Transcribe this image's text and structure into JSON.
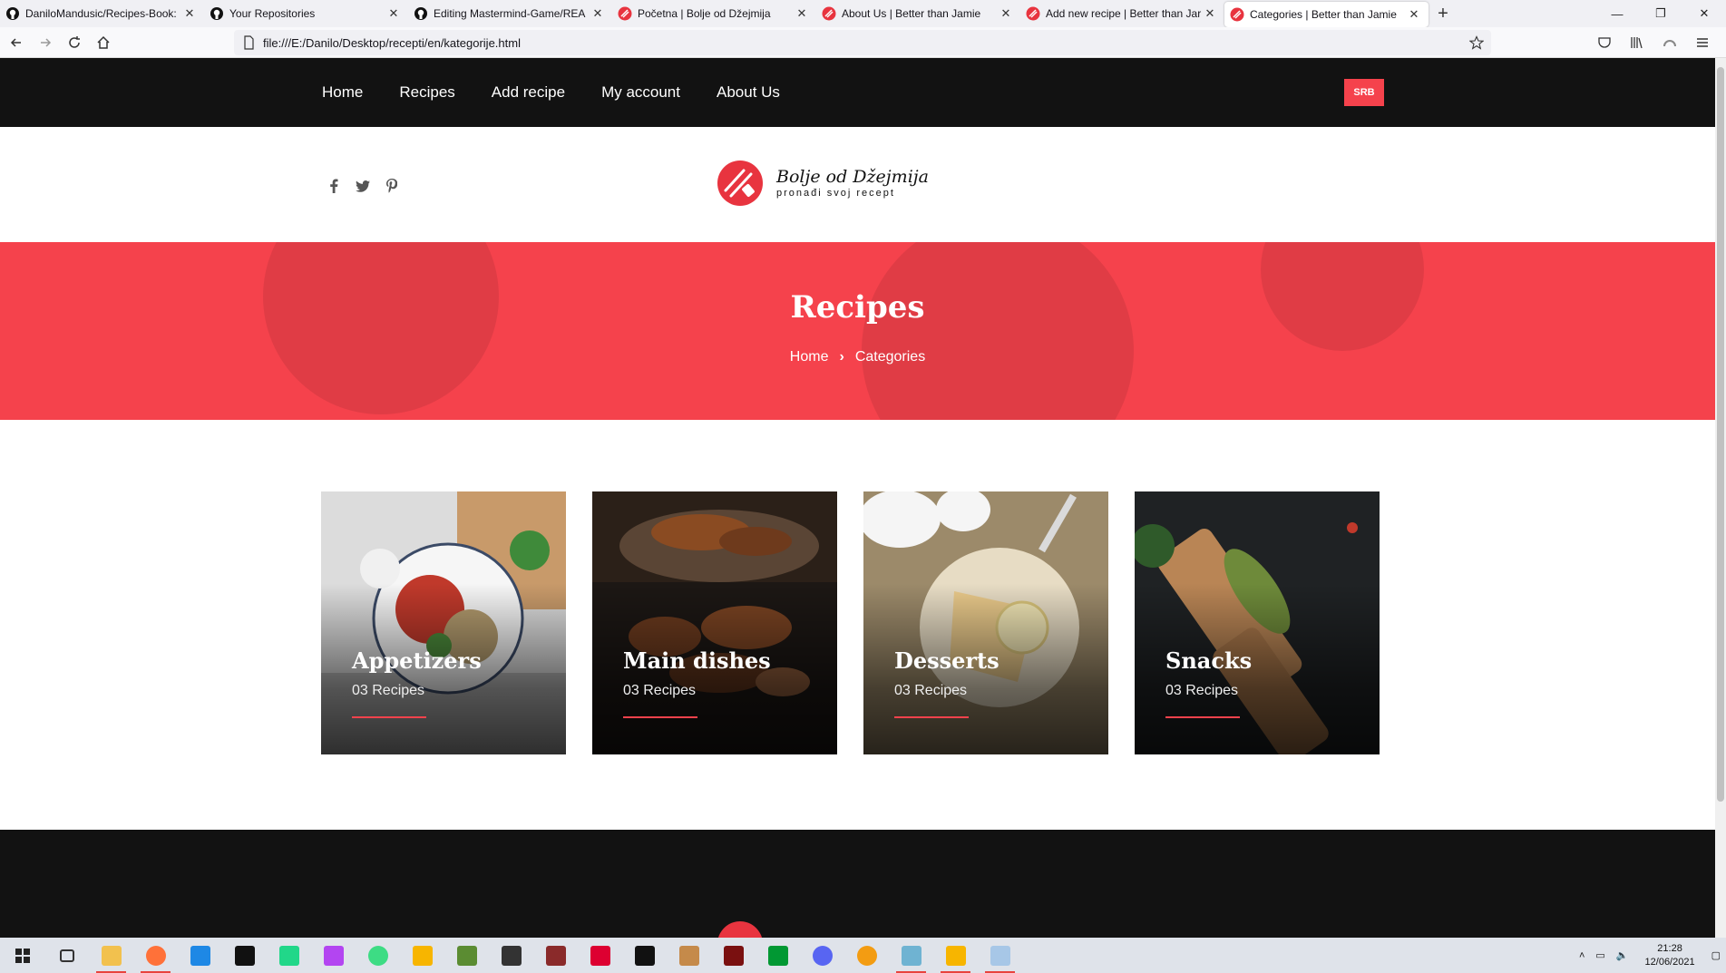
{
  "browser": {
    "tabs": [
      {
        "title": "DaniloMandusic/Recipes-Book:",
        "icon": "github-icon",
        "active": false
      },
      {
        "title": "Your Repositories",
        "icon": "github-icon",
        "active": false
      },
      {
        "title": "Editing Mastermind-Game/REA",
        "icon": "github-icon",
        "active": false
      },
      {
        "title": "Početna | Bolje od Džejmija",
        "icon": "site-logo-icon",
        "active": false
      },
      {
        "title": "About Us | Better than Jamie",
        "icon": "site-logo-icon",
        "active": false
      },
      {
        "title": "Add new recipe | Better than Jar",
        "icon": "site-logo-icon",
        "active": false
      },
      {
        "title": "Categories | Better than Jamie",
        "icon": "site-logo-icon",
        "active": true
      }
    ],
    "url": "file:///E:/Danilo/Desktop/recepti/en/kategorije.html"
  },
  "site": {
    "nav": {
      "home": "Home",
      "recipes": "Recipes",
      "add_recipe": "Add recipe",
      "my_account": "My account",
      "about_us": "About Us",
      "lang_button": "SRB"
    },
    "brand": {
      "name": "Bolje od Džejmija",
      "tagline": "pronađi svoj recept"
    },
    "hero": {
      "title": "Recipes",
      "breadcrumb_home": "Home",
      "breadcrumb_current": "Categories"
    },
    "categories": [
      {
        "title": "Appetizers",
        "count": "03 Recipes"
      },
      {
        "title": "Main dishes",
        "count": "03 Recipes"
      },
      {
        "title": "Desserts",
        "count": "03 Recipes"
      },
      {
        "title": "Snacks",
        "count": "03 Recipes"
      }
    ],
    "accent_color": "#f5424c",
    "dark_color": "#121212"
  },
  "taskbar": {
    "time": "21:28",
    "date": "12/06/2021"
  }
}
